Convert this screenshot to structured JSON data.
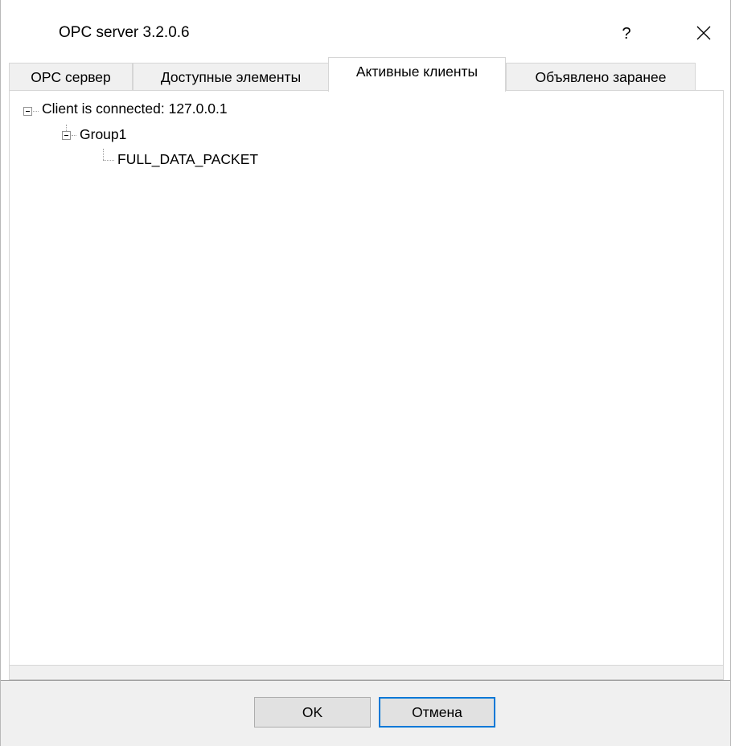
{
  "window": {
    "title": "OPC server 3.2.0.6",
    "help_label": "?",
    "close_icon": "close-icon"
  },
  "tabs": [
    {
      "label": "OPC сервер",
      "active": false
    },
    {
      "label": "Доступные элементы",
      "active": false
    },
    {
      "label": "Активные клиенты",
      "active": true
    },
    {
      "label": "Объявлено заранее",
      "active": false
    }
  ],
  "tree": {
    "client": "Client is connected: 127.0.0.1",
    "group": "Group1",
    "item": "FULL_DATA_PACKET"
  },
  "buttons": {
    "ok": "OK",
    "cancel": "Отмена"
  },
  "colors": {
    "accent": "#0078d7",
    "dialog_bg": "#f0f0f0"
  }
}
